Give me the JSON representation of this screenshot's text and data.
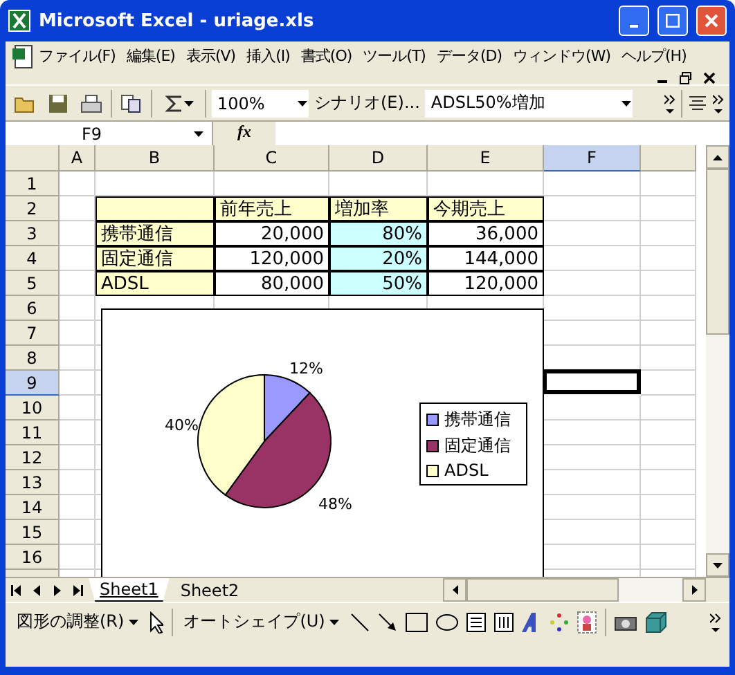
{
  "window": {
    "title": "Microsoft Excel - uriage.xls"
  },
  "menu": [
    {
      "label": "ファイル(F)"
    },
    {
      "label": "編集(E)"
    },
    {
      "label": "表示(V)"
    },
    {
      "label": "挿入(I)"
    },
    {
      "label": "書式(O)"
    },
    {
      "label": "ツール(T)"
    },
    {
      "label": "データ(D)"
    },
    {
      "label": "ウィンドウ(W)"
    },
    {
      "label": "ヘルプ(H)"
    }
  ],
  "toolbar": {
    "zoom": "100%",
    "scenario_label": "シナリオ(E)...",
    "scenario": "ADSL50%増加"
  },
  "formula_bar": {
    "name_box": "F9",
    "fx": "fx"
  },
  "sheet": {
    "columns": [
      {
        "label": "A",
        "selected": false
      },
      {
        "label": "B",
        "selected": false
      },
      {
        "label": "C",
        "selected": false
      },
      {
        "label": "D",
        "selected": false
      },
      {
        "label": "E",
        "selected": false
      },
      {
        "label": "F",
        "selected": true
      }
    ],
    "rows": [
      {
        "label": "1",
        "selected": false
      },
      {
        "label": "2",
        "selected": false,
        "cells": [
          {
            "kind": "header"
          },
          {
            "kind": "header",
            "text": "前年売上"
          },
          {
            "kind": "header",
            "text": "増加率"
          },
          {
            "kind": "header",
            "text": "今期売上"
          }
        ]
      },
      {
        "label": "3",
        "selected": false,
        "cells": [
          {
            "kind": "label",
            "text": "携帯通信"
          },
          {
            "kind": "number",
            "text": "20,000"
          },
          {
            "kind": "rate",
            "text": "80%"
          },
          {
            "kind": "number",
            "text": "36,000"
          }
        ]
      },
      {
        "label": "4",
        "selected": false,
        "cells": [
          {
            "kind": "label",
            "text": "固定通信"
          },
          {
            "kind": "number",
            "text": "120,000"
          },
          {
            "kind": "rate",
            "text": "20%"
          },
          {
            "kind": "number",
            "text": "144,000"
          }
        ]
      },
      {
        "label": "5",
        "selected": false,
        "cells": [
          {
            "kind": "label",
            "text": "ADSL"
          },
          {
            "kind": "number",
            "text": "80,000"
          },
          {
            "kind": "rate",
            "text": "50%"
          },
          {
            "kind": "number",
            "text": "120,000"
          }
        ]
      },
      {
        "label": "6",
        "selected": false
      },
      {
        "label": "7",
        "selected": false
      },
      {
        "label": "8",
        "selected": false
      },
      {
        "label": "9",
        "selected": true
      },
      {
        "label": "10",
        "selected": false
      },
      {
        "label": "11",
        "selected": false
      },
      {
        "label": "12",
        "selected": false
      },
      {
        "label": "13",
        "selected": false
      },
      {
        "label": "14",
        "selected": false
      },
      {
        "label": "15",
        "selected": false
      },
      {
        "label": "16",
        "selected": false
      }
    ]
  },
  "chart": {
    "chart_data": {
      "type": "pie",
      "categories": [
        "携帯通信",
        "固定通信",
        "ADSL"
      ],
      "values": [
        12,
        48,
        40
      ],
      "legend": "right",
      "colors": [
        "#9999ff",
        "#993366",
        "#ffffcc"
      ],
      "value_labels": [
        "12%",
        "48%",
        "40%"
      ]
    }
  },
  "sheet_tabs": [
    {
      "label": "Sheet1",
      "selected": true
    },
    {
      "label": "Sheet2",
      "selected": false
    }
  ],
  "drawing_toolbar": {
    "draw": "図形の調整(R)",
    "autoshapes": "オートシェイプ(U)"
  }
}
